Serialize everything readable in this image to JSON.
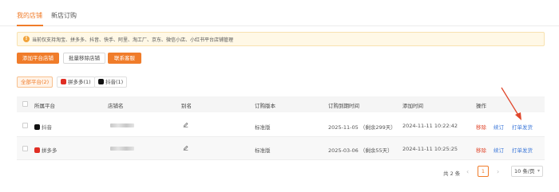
{
  "tabs": [
    {
      "label": "我的店铺",
      "active": true
    },
    {
      "label": "新店订购",
      "active": false
    }
  ],
  "notice": {
    "icon": "info-icon",
    "text": "当前仅支持淘宝、拼多多、抖音、快手、阿里、淘工厂、京东、微信小店、小红书平台店铺管理"
  },
  "actions": {
    "add_label": "添加平台店铺",
    "batch_remove_label": "批量移除店铺",
    "contact_label": "联系客服"
  },
  "filters": [
    {
      "label": "全部平台(2)",
      "active": true
    },
    {
      "label": "拼多多(1)",
      "icon": "pinduoduo-icon"
    },
    {
      "label": "抖音(1)",
      "icon": "douyin-icon"
    }
  ],
  "table": {
    "headers": [
      "所属平台",
      "店铺名",
      "别名",
      "订购版本",
      "订购到期时间",
      "添加时间",
      "操作"
    ],
    "rows": [
      {
        "platform": "抖音",
        "platform_icon": "douyin-icon",
        "version": "标准版",
        "expiry": "2025-11-05 （剩余299天）",
        "added": "2024-11-11 10:22:42",
        "actions": [
          "移除",
          "续订",
          "打单发货"
        ]
      },
      {
        "platform": "拼多多",
        "platform_icon": "pinduoduo-icon",
        "version": "标准版",
        "expiry": "2025-03-06 （剩余55天）",
        "added": "2024-11-11 10:25:25",
        "actions": [
          "移除",
          "续订",
          "打单发货"
        ]
      }
    ]
  },
  "pagination": {
    "total": "共 2 条",
    "current_page": "1",
    "page_size": "10 条/页"
  },
  "colors": {
    "accent": "#f07c2a",
    "remove": "#e0462b",
    "link": "#3a76d8",
    "annotation_arrow": "#e0462b"
  }
}
